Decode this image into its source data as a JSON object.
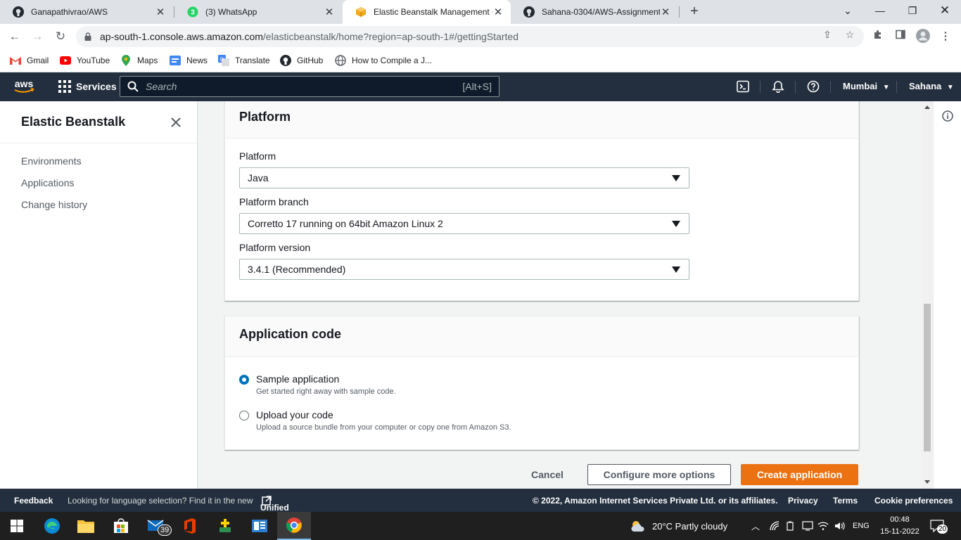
{
  "browser": {
    "tabs": [
      {
        "title": "Ganapathivrao/AWS",
        "icon": "github-icon"
      },
      {
        "title": "(3) WhatsApp",
        "icon": "whatsapp-icon",
        "badge": "3"
      },
      {
        "title": "Elastic Beanstalk Management Co",
        "icon": "aws-cube-icon"
      },
      {
        "title": "Sahana-0304/AWS-Assignment",
        "icon": "github-icon"
      }
    ],
    "url_host": "ap-south-1.console.aws.amazon.com",
    "url_path": "/elasticbeanstalk/home?region=ap-south-1#/gettingStarted",
    "bookmarks": [
      "Gmail",
      "YouTube",
      "Maps",
      "News",
      "Translate",
      "GitHub",
      "How to Compile a J..."
    ]
  },
  "aws_nav": {
    "services_label": "Services",
    "search_placeholder": "Search",
    "search_shortcut": "[Alt+S]",
    "region": "Mumbai",
    "user": "Sahana"
  },
  "sidebar": {
    "title": "Elastic Beanstalk",
    "items": [
      "Environments",
      "Applications",
      "Change history"
    ]
  },
  "platform_panel": {
    "heading": "Platform",
    "platform_label": "Platform",
    "platform_value": "Java",
    "branch_label": "Platform branch",
    "branch_value": "Corretto 17 running on 64bit Amazon Linux 2",
    "version_label": "Platform version",
    "version_value": "3.4.1 (Recommended)"
  },
  "code_panel": {
    "heading": "Application code",
    "options": [
      {
        "label": "Sample application",
        "desc": "Get started right away with sample code.",
        "selected": true
      },
      {
        "label": "Upload your code",
        "desc": "Upload a source bundle from your computer or copy one from Amazon S3.",
        "selected": false
      }
    ]
  },
  "actions": {
    "cancel": "Cancel",
    "configure": "Configure more options",
    "create": "Create application"
  },
  "footer": {
    "feedback": "Feedback",
    "lang_text": "Looking for language selection? Find it in the new",
    "unified": "Unified Settings",
    "copyright": "© 2022, Amazon Internet Services Private Ltd. or its affiliates.",
    "privacy": "Privacy",
    "terms": "Terms",
    "cookies": "Cookie preferences"
  },
  "taskbar": {
    "mail_badge": "39",
    "weather": "20°C  Partly cloudy",
    "lang": "ENG",
    "time": "00:48",
    "date": "15-11-2022",
    "notif_count": "20"
  },
  "colors": {
    "aws_dark": "#232f3e",
    "aws_orange": "#ec7211",
    "aws_blue": "#0073bb"
  }
}
